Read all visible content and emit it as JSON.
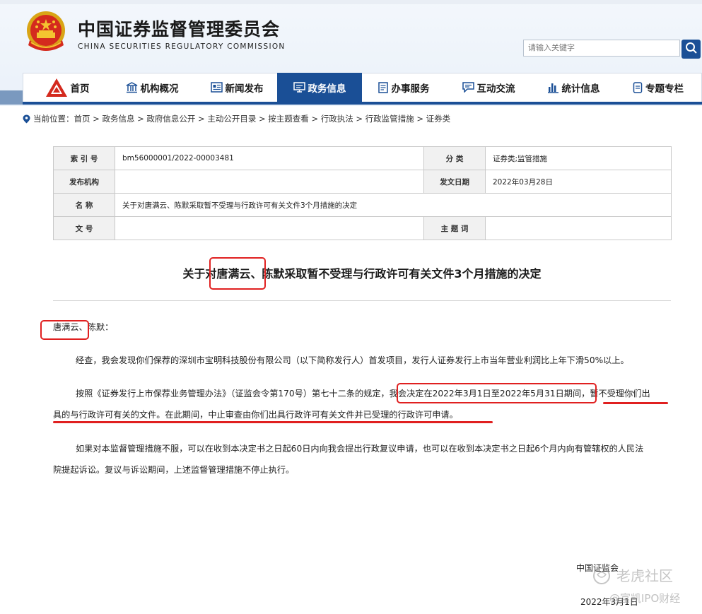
{
  "site": {
    "title_cn": "中国证券监督管理委员会",
    "title_en": "CHINA SECURITIES REGULATORY COMMISSION"
  },
  "search": {
    "placeholder": "请输入关键字"
  },
  "nav": {
    "items": [
      {
        "label": "首页",
        "icon": "logo-icon"
      },
      {
        "label": "机构概况",
        "icon": "building-icon"
      },
      {
        "label": "新闻发布",
        "icon": "newspaper-icon"
      },
      {
        "label": "政务信息",
        "icon": "monitor-icon"
      },
      {
        "label": "办事服务",
        "icon": "document-icon"
      },
      {
        "label": "互动交流",
        "icon": "chat-icon"
      },
      {
        "label": "统计信息",
        "icon": "bar-chart-icon"
      },
      {
        "label": "专题专栏",
        "icon": "bookmark-icon"
      }
    ],
    "active_index": 3
  },
  "breadcrumb": {
    "prefix": "当前位置：",
    "path": "首页 > 政务信息 > 政府信息公开 > 主动公开目录 > 按主题查看 > 行政执法 > 行政监管措施 > 证券类"
  },
  "meta": {
    "index_label": "索 引 号",
    "index_value": "bm56000001/2022-00003481",
    "category_label": "分 类",
    "category_value": "证券类;监管措施",
    "publisher_label": "发布机构",
    "publisher_value": "",
    "date_label": "发文日期",
    "date_value": "2022年03月28日",
    "name_label": "名 称",
    "name_value": "关于对唐满云、陈默采取暂不受理与行政许可有关文件3个月措施的决定",
    "docno_label": "文 号",
    "docno_value": "",
    "keyword_label": "主 题 词",
    "keyword_value": ""
  },
  "document": {
    "title": "关于对唐满云、陈默采取暂不受理与行政许可有关文件3个月措施的决定",
    "salutation": "唐满云、陈默：",
    "p1": "经查，我会发现你们保荐的深圳市宝明科技股份有限公司（以下简称发行人）首发项目，发行人证券发行上市当年营业利润比上年下滑50%以上。",
    "p2_line1": "按照《证券发行上市保荐业务管理办法》（证监会令第170号）第七十二条的规定，我会决定在2022年3月1日至2022年5月31日期间，暂不受理你们出",
    "p2_line2": "具的与行政许可有关的文件。在此期间，中止审查由你们出具行政许可有关文件并已受理的行政许可申请。",
    "p3_line1": "如果对本监督管理措施不服，可以在收到本决定书之日起60日内向我会提出行政复议申请，也可以在收到本决定书之日起6个月内向有管辖权的人民法",
    "p3_line2": "院提起诉讼。复议与诉讼期间，上述监督管理措施不停止执行。",
    "signer": "中国证监会",
    "sign_date": "2022年3月1日"
  },
  "watermark": {
    "line1": "老虎社区",
    "line2": "@富凯IPO财经"
  },
  "colors": {
    "nav_active": "#1a4f96",
    "highlight_red": "#e02020"
  }
}
